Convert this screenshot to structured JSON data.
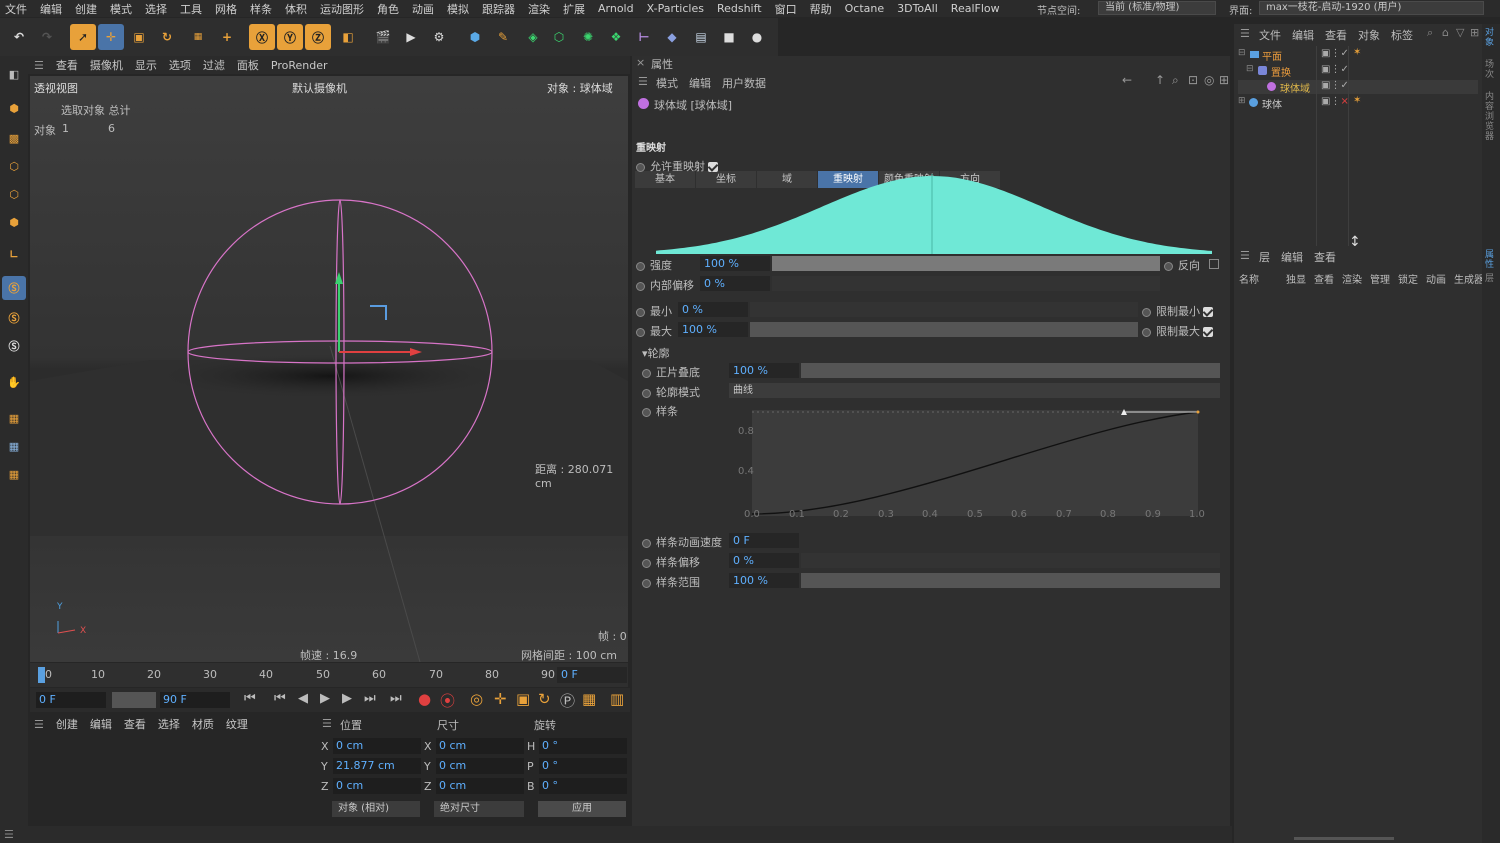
{
  "menubar": {
    "items": [
      "文件",
      "编辑",
      "创建",
      "模式",
      "选择",
      "工具",
      "网格",
      "样条",
      "体积",
      "运动图形",
      "角色",
      "动画",
      "模拟",
      "跟踪器",
      "渲染",
      "扩展",
      "Arnold",
      "X-Particles",
      "Redshift",
      "窗口",
      "帮助",
      "Octane",
      "3DToAll",
      "RealFlow"
    ],
    "node_space_label": "节点空间:",
    "node_space_value": "当前 (标准/物理)",
    "layout_label": "界面:",
    "layout_value": "max一枝花-启动-1920 (用户)"
  },
  "viewport": {
    "menu": [
      "查看",
      "摄像机",
      "显示",
      "选项",
      "过滤",
      "面板",
      "ProRender"
    ],
    "name": "透视视图",
    "camera": "默认摄像机",
    "object_label": "对象 : 球体域",
    "stats_header": "选取对象 总计",
    "stats_label": "对象",
    "stats_selected": "1",
    "stats_total": "6",
    "distance": "距离 : 280.071 cm",
    "speed": "帧速 : 16.9",
    "grid_spacing": "网格间距 : 100 cm",
    "frame": "帧 : 0",
    "axis_y": "Y",
    "axis_x": "X"
  },
  "timeline": {
    "ticks": [
      "0",
      "10",
      "20",
      "30",
      "40",
      "50",
      "60",
      "70",
      "80",
      "90"
    ],
    "current_frame": "0 F"
  },
  "transport": {
    "start": "0 F",
    "end": "90 F"
  },
  "material_menu": [
    "创建",
    "编辑",
    "查看",
    "选择",
    "材质",
    "纹理"
  ],
  "coords": {
    "headers": [
      "位置",
      "尺寸",
      "旋转"
    ],
    "rows": [
      {
        "axis": "X",
        "pos": "0 cm",
        "size_axis": "X",
        "size": "0 cm",
        "rot_axis": "H",
        "rot": "0 °"
      },
      {
        "axis": "Y",
        "pos": "21.877 cm",
        "size_axis": "Y",
        "size": "0 cm",
        "rot_axis": "P",
        "rot": "0 °"
      },
      {
        "axis": "Z",
        "pos": "0 cm",
        "size_axis": "Z",
        "size": "0 cm",
        "rot_axis": "B",
        "rot": "0 °"
      }
    ],
    "mode_left": "对象 (相对)",
    "mode_right": "绝对尺寸",
    "apply": "应用"
  },
  "attributes": {
    "title": "属性",
    "menu": [
      "模式",
      "编辑",
      "用户数据"
    ],
    "object_name": "球体域 [球体域]",
    "tabs": [
      "基本",
      "坐标",
      "域",
      "重映射",
      "颜色重映射",
      "方向"
    ],
    "active_tab": "重映射",
    "section": "重映射",
    "enable_remap": "允许重映射",
    "strength_label": "强度",
    "strength_value": "100 %",
    "strength_fraction": 1.0,
    "invert_label": "反向",
    "inner_offset_label": "内部偏移",
    "inner_offset_value": "0 %",
    "min_label": "最小",
    "min_value": "0 %",
    "max_label": "最大",
    "max_value": "100 %",
    "clamp_min": "限制最小",
    "clamp_max": "限制最大",
    "contour_section": "轮廓",
    "stack_label": "正片叠底",
    "stack_value": "100 %",
    "contour_mode_label": "轮廓模式",
    "contour_mode_value": "曲线",
    "spline_label": "样条",
    "spline_y_ticks": [
      "0.8",
      "0.4"
    ],
    "spline_x_ticks": [
      "0.0",
      "0.1",
      "0.2",
      "0.3",
      "0.4",
      "0.5",
      "0.6",
      "0.7",
      "0.8",
      "0.9",
      "1.0"
    ],
    "spline_anim_label": "样条动画速度",
    "spline_anim_value": "0 F",
    "spline_offset_label": "样条偏移",
    "spline_offset_value": "0 %",
    "spline_range_label": "样条范围",
    "spline_range_value": "100 %",
    "curve_color": "#6fe8d6"
  },
  "object_manager": {
    "menu": [
      "文件",
      "编辑",
      "查看",
      "对象",
      "标签"
    ],
    "objects": [
      {
        "name": "平面",
        "color": "#e89a3c",
        "indent": 0
      },
      {
        "name": "置换",
        "color": "#e89a3c",
        "indent": 1
      },
      {
        "name": "球体域",
        "color": "#e0b84a",
        "indent": 2
      },
      {
        "name": "球体",
        "color": "#c8c8c8",
        "indent": 0
      }
    ]
  },
  "layer_manager": {
    "menu": [
      "层",
      "编辑",
      "查看"
    ],
    "columns": [
      "名称",
      "独显",
      "查看",
      "渲染",
      "管理",
      "锁定",
      "动画",
      "生成器"
    ]
  },
  "right_strip": [
    "对象",
    "场次",
    "内容浏览器",
    "属性",
    "层"
  ]
}
